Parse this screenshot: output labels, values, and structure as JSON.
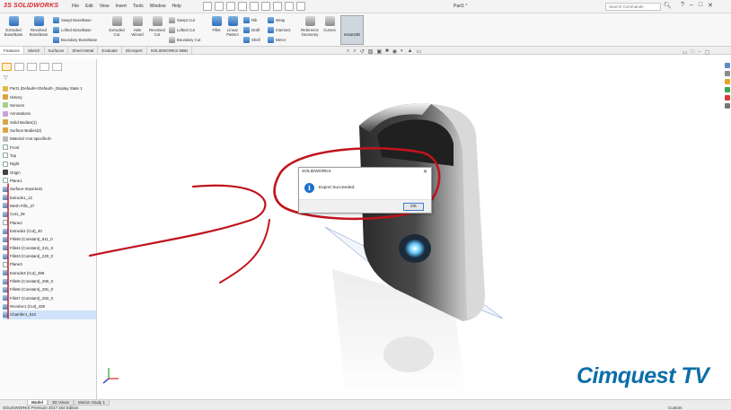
{
  "app": {
    "logo_ds": "3S",
    "logo_text": "SOLIDWORKS",
    "document_title": "Part1 *",
    "search_placeholder": "Search Commands"
  },
  "menu": [
    "File",
    "Edit",
    "View",
    "Insert",
    "Tools",
    "Window",
    "Help"
  ],
  "ribbon": {
    "extruded_boss": "Extruded Boss/Base",
    "revolved_boss": "Revolved Boss/Base",
    "swept_boss": "Swept Boss/Base",
    "lofted_boss": "Lofted Boss/Base",
    "boundary_boss": "Boundary Boss/Base",
    "extruded_cut": "Extruded Cut",
    "hole_wizard": "Hole Wizard",
    "revolved_cut": "Revolved Cut",
    "swept_cut": "Swept Cut",
    "lofted_cut": "Lofted Cut",
    "boundary_cut": "Boundary Cut",
    "fillet": "Fillet",
    "linear_pattern": "Linear Pattern",
    "rib": "Rib",
    "draft": "Draft",
    "shell": "Shell",
    "wrap": "Wrap",
    "intersect": "Intersect",
    "mirror": "Mirror",
    "reference_geometry": "Reference Geometry",
    "curves": "Curves",
    "instant3d": "Instant3D"
  },
  "tabs": [
    "Features",
    "Sketch",
    "Surfaces",
    "Sheet Metal",
    "Evaluate",
    "DimXpert",
    "SOLIDWORKS MBD"
  ],
  "feature_tree": [
    {
      "label": "Part1  (Default<<Default>_Display State 1",
      "icon": "doc"
    },
    {
      "label": "History",
      "icon": "fold"
    },
    {
      "label": "Sensors",
      "icon": "sens"
    },
    {
      "label": "Annotations",
      "icon": "ann"
    },
    {
      "label": "Solid Bodies(1)",
      "icon": "fold"
    },
    {
      "label": "Surface Bodies(2)",
      "icon": "fold"
    },
    {
      "label": "Material <not specified>",
      "icon": "mat"
    },
    {
      "label": "Front",
      "icon": "plane"
    },
    {
      "label": "Top",
      "icon": "plane"
    },
    {
      "label": "Right",
      "icon": "plane"
    },
    {
      "label": "Origin",
      "icon": "orig"
    },
    {
      "label": "Plane1",
      "icon": "plane"
    },
    {
      "label": "Surface-Imported1",
      "icon": "feat"
    },
    {
      "label": "Extrude1_12",
      "icon": "feat"
    },
    {
      "label": "Mesh Fill1_27",
      "icon": "feat"
    },
    {
      "label": "Cut1_28",
      "icon": "feat"
    },
    {
      "label": "Plane2",
      "icon": "plane"
    },
    {
      "label": "Extrude2 (Cut)_40",
      "icon": "feat"
    },
    {
      "label": "Fillet8 (Constant)_511_0",
      "icon": "feat"
    },
    {
      "label": "Fillet4 (Constant)_221_0",
      "icon": "feat"
    },
    {
      "label": "Fillet3 (Constant)_220_0",
      "icon": "feat"
    },
    {
      "label": "Plane3",
      "icon": "plane"
    },
    {
      "label": "Extrude3 (Cut)_289",
      "icon": "feat"
    },
    {
      "label": "Fillet5 (Constant)_290_0",
      "icon": "feat"
    },
    {
      "label": "Fillet6 (Constant)_281_0",
      "icon": "feat"
    },
    {
      "label": "Fillet7 (Constant)_292_0",
      "icon": "feat"
    },
    {
      "label": "Revolve1 (Cut)_436",
      "icon": "feat"
    },
    {
      "label": "Chamfer1_510",
      "icon": "feat"
    }
  ],
  "dialog": {
    "title": "SOLIDWORKS",
    "message": "Export Succeeded.",
    "ok_label": "OK",
    "info_symbol": "i"
  },
  "bottom_tabs": [
    "Model",
    "3D Views",
    "Motion Study 1"
  ],
  "status": {
    "edition": "SOLIDWORKS Premium 2017 x64 Edition",
    "units": "Custom"
  },
  "watermark": "Cimquest TV",
  "colors": {
    "annotation_red": "#c0141c",
    "solidworks_red": "#d9262c",
    "watermark_blue": "#0d6ea8",
    "selection_blue": "#cfe3fa"
  }
}
